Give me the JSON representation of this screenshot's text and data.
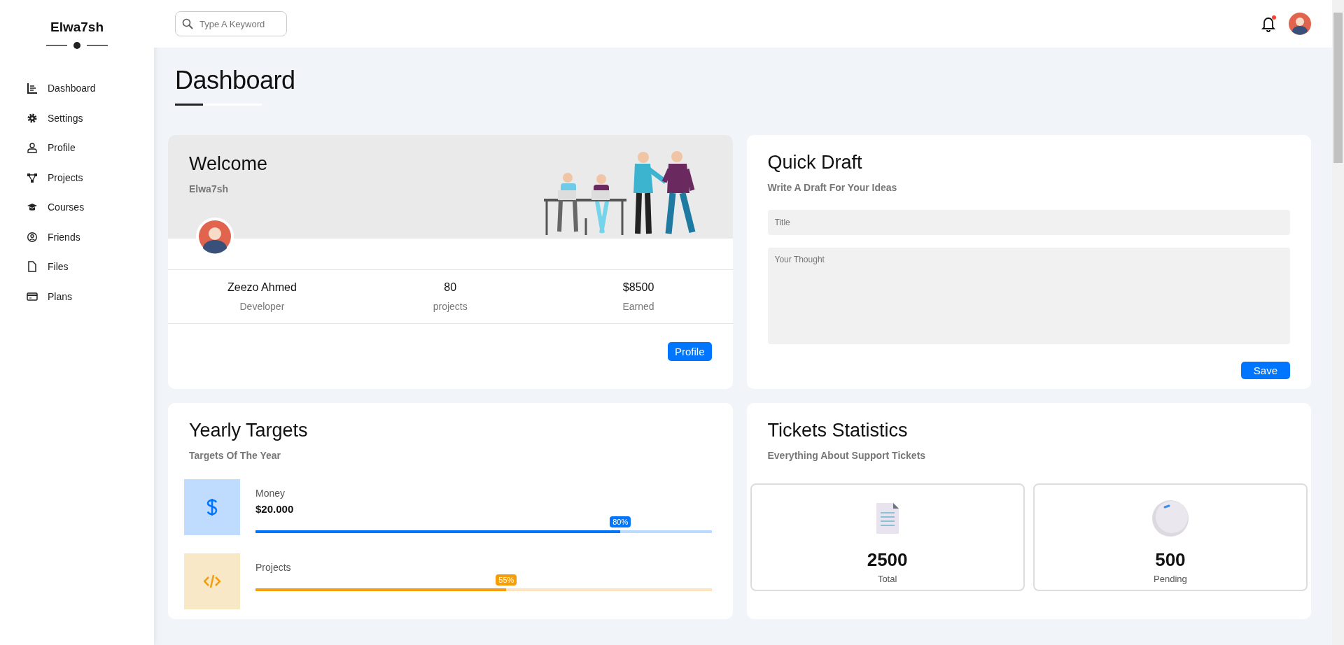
{
  "sidebar": {
    "brand": "Elwa7sh",
    "items": [
      {
        "label": "Dashboard"
      },
      {
        "label": "Settings"
      },
      {
        "label": "Profile"
      },
      {
        "label": "Projects"
      },
      {
        "label": "Courses"
      },
      {
        "label": "Friends"
      },
      {
        "label": "Files"
      },
      {
        "label": "Plans"
      }
    ]
  },
  "topbar": {
    "search": {
      "placeholder": "Type A Keyword"
    },
    "notifications": {
      "unread": true
    }
  },
  "page_title": "Dashboard",
  "welcome": {
    "title": "Welcome",
    "name": "Elwa7sh",
    "stats": [
      {
        "value": "Zeezo Ahmed",
        "label": "Developer"
      },
      {
        "value": "80",
        "label": "projects"
      },
      {
        "value": "$8500",
        "label": "Earned"
      }
    ],
    "button": "Profile"
  },
  "quick_draft": {
    "title": "Quick Draft",
    "subtitle": "Write A Draft For Your Ideas",
    "fields": [
      {
        "kind": "input",
        "placeholder": "Title"
      },
      {
        "kind": "textarea",
        "placeholder": "Your Thought"
      }
    ],
    "button": "Save"
  },
  "yearly_targets": {
    "title": "Yearly Targets",
    "subtitle": "Targets Of The Year",
    "targets": [
      {
        "kind": "money",
        "label": "Money",
        "value": "$20.000",
        "level": 0.8,
        "badge": "80%",
        "color": "#0075ff"
      },
      {
        "kind": "projects",
        "label": "Projects",
        "level": 0.55,
        "badge": "55%",
        "color": "#f59e0b"
      }
    ]
  },
  "tickets": {
    "title": "Tickets Statistics",
    "subtitle": "Everything About Support Tickets",
    "stats": [
      {
        "kind": "total",
        "value": "2500",
        "label": "Total"
      },
      {
        "kind": "pending",
        "value": "500",
        "label": "Pending"
      }
    ]
  }
}
